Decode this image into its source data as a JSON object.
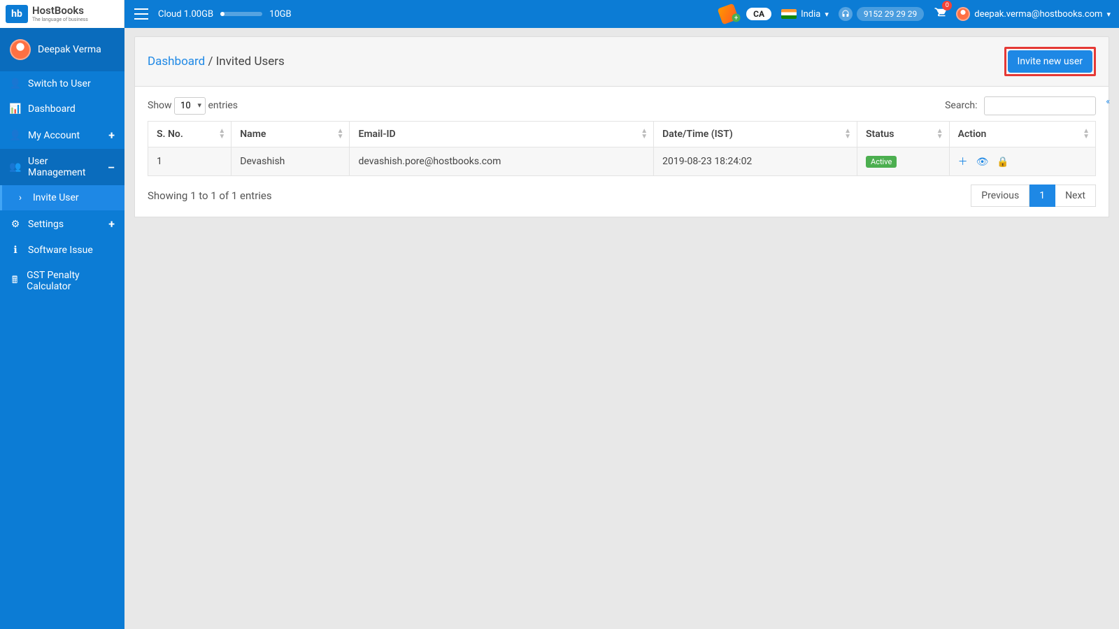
{
  "brand": {
    "logo_abbr": "hb",
    "name": "HostBooks",
    "tagline": "The language of business"
  },
  "topbar": {
    "cloud_label": "Cloud 1.00GB",
    "cloud_quota": "10GB",
    "country": "India",
    "phone": "9152 29 29 29",
    "cart_count": "0",
    "user_email": "deepak.verma@hostbooks.com"
  },
  "sidebar": {
    "user_name": "Deepak Verma",
    "items": [
      {
        "icon": "👤",
        "label": "Switch to User",
        "exp": ""
      },
      {
        "icon": "📊",
        "label": "Dashboard",
        "exp": ""
      },
      {
        "icon": "👤",
        "label": "My Account",
        "exp": "+"
      },
      {
        "icon": "👥",
        "label": "User Management",
        "exp": "–",
        "active": true
      },
      {
        "icon": "›",
        "label": "Invite User",
        "sub": true
      },
      {
        "icon": "⚙",
        "label": "Settings",
        "exp": "+"
      },
      {
        "icon": "ℹ",
        "label": "Software Issue",
        "exp": ""
      },
      {
        "icon": "🖩",
        "label": "GST Penalty Calculator",
        "exp": ""
      }
    ]
  },
  "page": {
    "breadcrumb_root": "Dashboard",
    "breadcrumb_sep": " / ",
    "breadcrumb_current": "Invited Users",
    "invite_button": "Invite new user",
    "show_label": "Show",
    "entries_label": "entries",
    "length_value": "10",
    "search_label": "Search:",
    "columns": [
      "S. No.",
      "Name",
      "Email-ID",
      "Date/Time (IST)",
      "Status",
      "Action"
    ],
    "rows": [
      {
        "sno": "1",
        "name": "Devashish",
        "email": "devashish.pore@hostbooks.com",
        "dt": "2019-08-23 18:24:02",
        "status": "Active"
      }
    ],
    "info": "Showing 1 to 1 of 1 entries",
    "prev": "Previous",
    "page1": "1",
    "next": "Next"
  }
}
